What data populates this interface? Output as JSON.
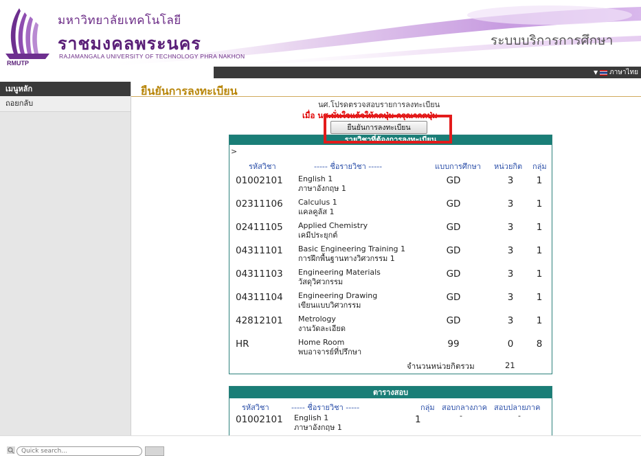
{
  "header": {
    "logo_text": "RMUTP",
    "university_thai_line1": "มหาวิทยาลัยเทคโนโลยี",
    "university_thai_line2": "ราชมงคลพระนคร",
    "university_english": "RAJAMANGALA UNIVERSITY OF TECHNOLOGY PHRA NAKHON",
    "system_name": "ระบบบริการการศึกษา",
    "language_label": "ภาษาไทย"
  },
  "sidebar": {
    "header": "เมนูหลัก",
    "items": [
      {
        "label": "ถอยกลับ"
      }
    ]
  },
  "main": {
    "page_title": "ยืนยันการลงทะเบียน",
    "notice_line1": "นศ.โปรดตรวจสอบรายการลงทะเบียน",
    "notice_line2": "เมื่อ นศ.มั่นใจแล้วให้กดปุ่ม กรุณากดปุ่ม",
    "confirm_button": "ยืนยันการลงทะเบียน",
    "highlight_color": "#e31b1b"
  },
  "courses": {
    "title": "รายวิชาที่ต้องการลงทะเบียน",
    "caret": ">",
    "headers": {
      "code": "รหัสวิชา",
      "name": "----- ชื่อรายวิชา -----",
      "mode": "แบบการศึกษา",
      "credits": "หน่วยกิต",
      "group": "กลุ่ม"
    },
    "rows": [
      {
        "code": "01002101",
        "name_en": "English 1",
        "name_th": "ภาษาอังกฤษ 1",
        "mode": "GD",
        "credits": "3",
        "group": "1"
      },
      {
        "code": "02311106",
        "name_en": "Calculus 1",
        "name_th": "แคลคูลัส 1",
        "mode": "GD",
        "credits": "3",
        "group": "1"
      },
      {
        "code": "02411105",
        "name_en": "Applied Chemistry",
        "name_th": "เคมีประยุกต์",
        "mode": "GD",
        "credits": "3",
        "group": "1"
      },
      {
        "code": "04311101",
        "name_en": "Basic Engineering Training 1",
        "name_th": "การฝึกพื้นฐานทางวิศวกรรม 1",
        "mode": "GD",
        "credits": "3",
        "group": "1"
      },
      {
        "code": "04311103",
        "name_en": "Engineering Materials",
        "name_th": "วัสดุวิศวกรรม",
        "mode": "GD",
        "credits": "3",
        "group": "1"
      },
      {
        "code": "04311104",
        "name_en": "Engineering Drawing",
        "name_th": "เขียนแบบวิศวกรรม",
        "mode": "GD",
        "credits": "3",
        "group": "1"
      },
      {
        "code": "42812101",
        "name_en": "Metrology",
        "name_th": "งานวัดละเอียด",
        "mode": "GD",
        "credits": "3",
        "group": "1"
      },
      {
        "code": "HR",
        "name_en": "Home Room",
        "name_th": "พบอาจารย์ที่ปรึกษา",
        "mode": "99",
        "credits": "0",
        "group": "8"
      }
    ],
    "total_label": "จำนวนหน่วยกิตรวม",
    "total_value": "21"
  },
  "exam": {
    "title": "ตารางสอบ",
    "headers": {
      "code": "รหัสวิชา",
      "name": "----- ชื่อรายวิชา -----",
      "group": "กลุ่ม",
      "midterm": "สอบกลางภาค",
      "final": "สอบปลายภาค"
    },
    "rows": [
      {
        "code": "01002101",
        "name_en": "English 1",
        "name_th": "ภาษาอังกฤษ 1",
        "group": "1",
        "midterm": "-",
        "final": "-"
      }
    ]
  },
  "footer": {
    "search_placeholder": "Quick search..."
  }
}
